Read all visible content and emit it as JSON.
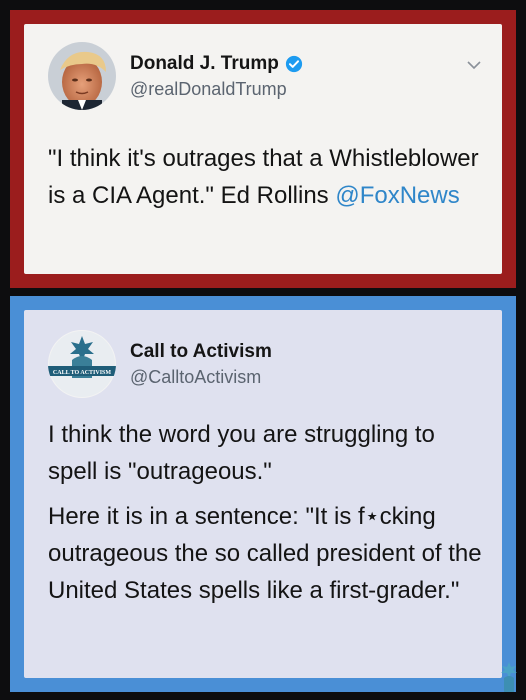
{
  "tweet1": {
    "name": "Donald J. Trump",
    "handle": "@realDonaldTrump",
    "text_main": "\"I think it's outrages that a Whistleblower is a CIA Agent.\" Ed Rollins ",
    "mention": "@FoxNews",
    "border_color": "#9b1d1d"
  },
  "tweet2": {
    "name": "Call to Activism",
    "handle": "@CalltoActivism",
    "avatar_text": "CALL TO ACTIVISM",
    "para1": "I think the word you are struggling to spell is \"outrageous.\"",
    "para2": "Here it is in a sentence: \"It is f⋆cking outrageous the so called president of the United States spells like a first-grader.\"",
    "border_color": "#4a8fd6"
  },
  "icons": [
    "verified-badge-icon",
    "chevron-down-icon",
    "liberty-logo-icon"
  ]
}
